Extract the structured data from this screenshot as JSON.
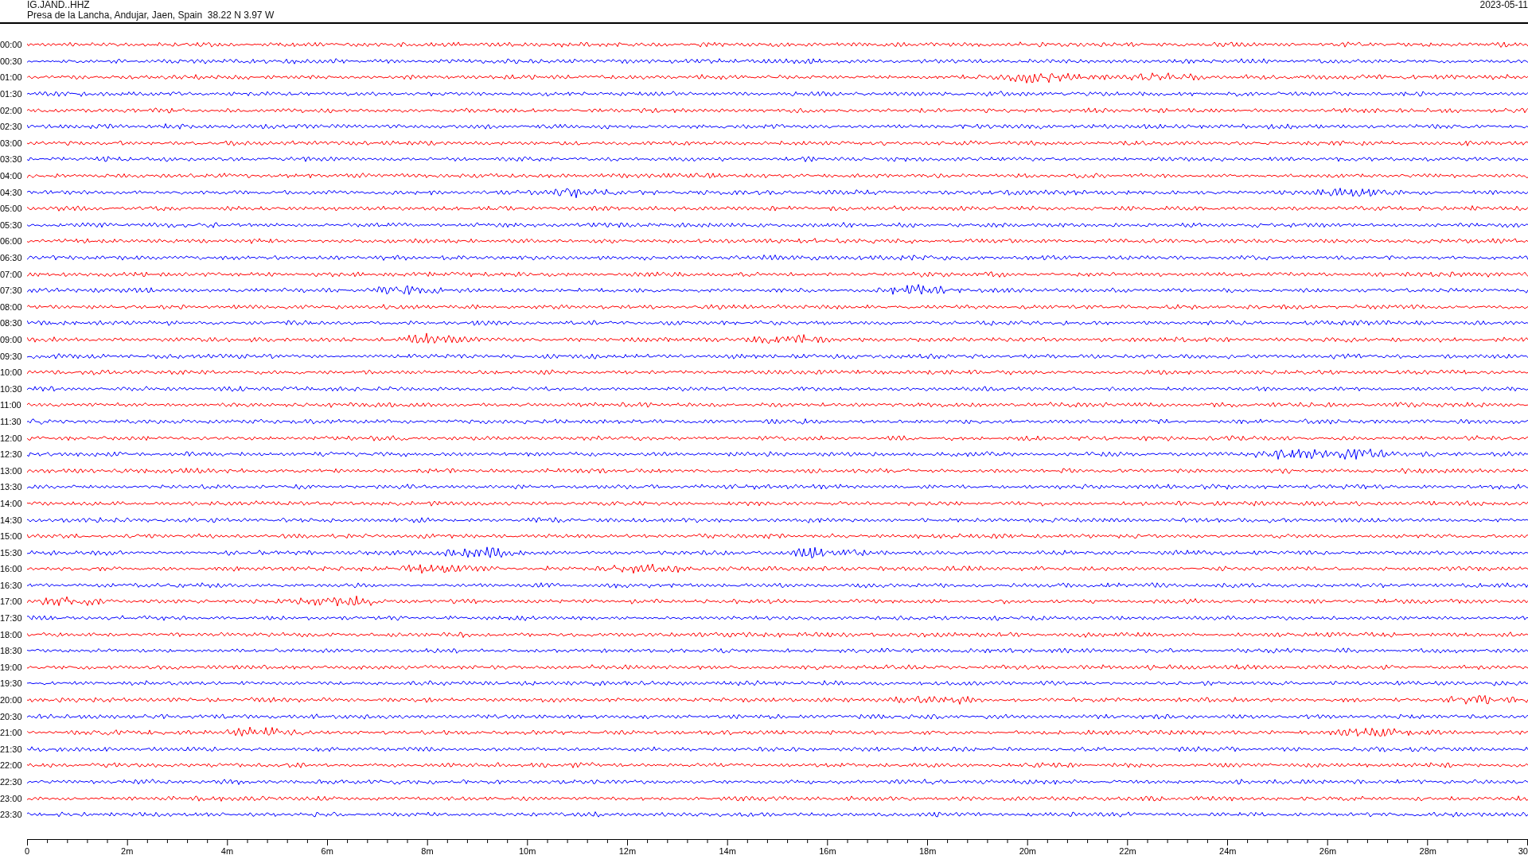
{
  "header": {
    "station": "IG.JAND..HHZ",
    "location": "Presa de la Lancha, Andujar, Jaen, Spain  38.22 N 3.97 W",
    "date": "2023-05-11"
  },
  "rows": [
    {
      "time": "00:00",
      "color": "#ff0000"
    },
    {
      "time": "00:30",
      "color": "#0000ff"
    },
    {
      "time": "01:00",
      "color": "#ff0000"
    },
    {
      "time": "01:30",
      "color": "#0000ff"
    },
    {
      "time": "02:00",
      "color": "#ff0000"
    },
    {
      "time": "02:30",
      "color": "#0000ff"
    },
    {
      "time": "03:00",
      "color": "#ff0000"
    },
    {
      "time": "03:30",
      "color": "#0000ff"
    },
    {
      "time": "04:00",
      "color": "#ff0000"
    },
    {
      "time": "04:30",
      "color": "#0000ff"
    },
    {
      "time": "05:00",
      "color": "#ff0000"
    },
    {
      "time": "05:30",
      "color": "#0000ff"
    },
    {
      "time": "06:00",
      "color": "#ff0000"
    },
    {
      "time": "06:30",
      "color": "#0000ff"
    },
    {
      "time": "07:00",
      "color": "#ff0000"
    },
    {
      "time": "07:30",
      "color": "#0000ff"
    },
    {
      "time": "08:00",
      "color": "#ff0000"
    },
    {
      "time": "08:30",
      "color": "#0000ff"
    },
    {
      "time": "09:00",
      "color": "#ff0000"
    },
    {
      "time": "09:30",
      "color": "#0000ff"
    },
    {
      "time": "10:00",
      "color": "#ff0000"
    },
    {
      "time": "10:30",
      "color": "#0000ff"
    },
    {
      "time": "11:00",
      "color": "#ff0000"
    },
    {
      "time": "11:30",
      "color": "#0000ff"
    },
    {
      "time": "12:00",
      "color": "#ff0000"
    },
    {
      "time": "12:30",
      "color": "#0000ff"
    },
    {
      "time": "13:00",
      "color": "#ff0000"
    },
    {
      "time": "13:30",
      "color": "#0000ff"
    },
    {
      "time": "14:00",
      "color": "#ff0000"
    },
    {
      "time": "14:30",
      "color": "#0000ff"
    },
    {
      "time": "15:00",
      "color": "#ff0000"
    },
    {
      "time": "15:30",
      "color": "#0000ff"
    },
    {
      "time": "16:00",
      "color": "#ff0000"
    },
    {
      "time": "16:30",
      "color": "#0000ff"
    },
    {
      "time": "17:00",
      "color": "#ff0000"
    },
    {
      "time": "17:30",
      "color": "#0000ff"
    },
    {
      "time": "18:00",
      "color": "#ff0000"
    },
    {
      "time": "18:30",
      "color": "#0000ff"
    },
    {
      "time": "19:00",
      "color": "#ff0000"
    },
    {
      "time": "19:30",
      "color": "#0000ff"
    },
    {
      "time": "20:00",
      "color": "#ff0000"
    },
    {
      "time": "20:30",
      "color": "#0000ff"
    },
    {
      "time": "21:00",
      "color": "#ff0000"
    },
    {
      "time": "21:30",
      "color": "#0000ff"
    },
    {
      "time": "22:00",
      "color": "#ff0000"
    },
    {
      "time": "22:30",
      "color": "#0000ff"
    },
    {
      "time": "23:00",
      "color": "#ff0000"
    },
    {
      "time": "23:30",
      "color": "#0000ff"
    }
  ],
  "axis": {
    "labels": [
      "0",
      "2m",
      "4m",
      "6m",
      "8m",
      "10m",
      "12m",
      "14m",
      "16m",
      "18m",
      "20m",
      "22m",
      "24m",
      "26m",
      "28m",
      "30"
    ]
  }
}
